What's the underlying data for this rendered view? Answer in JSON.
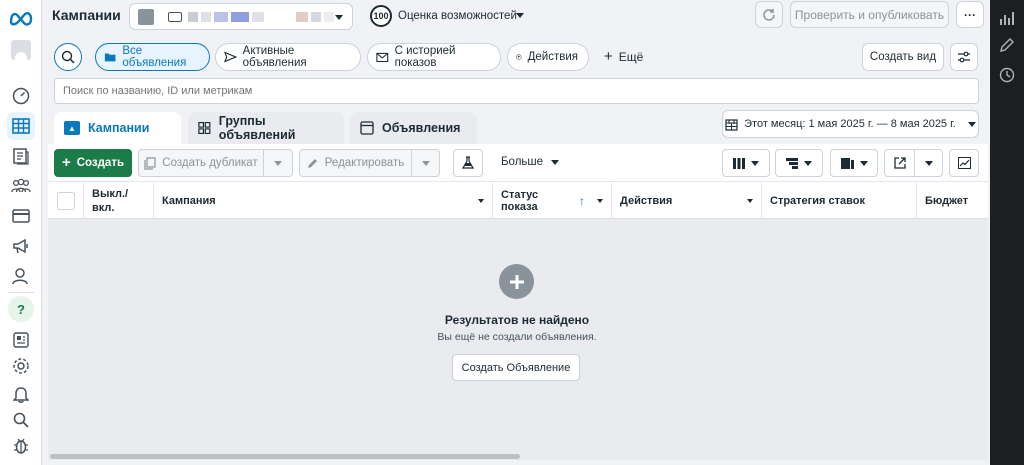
{
  "header": {
    "title": "Кампании",
    "opportunity_score": "100",
    "opportunity_label": "Оценка возможностей",
    "review_publish": "Проверить и опубликовать",
    "more": "···"
  },
  "filters": {
    "items": [
      {
        "label": "Все объявления",
        "selected": true,
        "icon": "folder-icon"
      },
      {
        "label": "Активные объявления",
        "selected": false,
        "icon": "send-icon"
      },
      {
        "label": "С историей показов",
        "selected": false,
        "icon": "mail-icon"
      },
      {
        "label": "Действия",
        "selected": false,
        "icon": "arrow-up-circle-icon"
      }
    ],
    "more_label": "Ещё",
    "create_view": "Создать вид"
  },
  "search": {
    "placeholder": "Поиск по названию, ID или метрикам"
  },
  "tabs": [
    {
      "label": "Кампании",
      "active": true
    },
    {
      "label": "Группы объявлений",
      "active": false
    },
    {
      "label": "Объявления",
      "active": false
    }
  ],
  "date_range": "Этот месяц: 1 мая 2025 г. — 8 мая 2025 г.",
  "toolbar": {
    "create": "Создать",
    "duplicate": "Создать дубликат",
    "edit": "Редактировать",
    "more": "Больше"
  },
  "table": {
    "columns": [
      "Выкл./\nвкл.",
      "Кампания",
      "Статус показа",
      "Действия",
      "Стратегия ставок",
      "Бюджет"
    ]
  },
  "empty": {
    "title": "Результатов не найдено",
    "subtitle": "Вы ещё не создали объявления.",
    "button": "Создать Объявление"
  },
  "colors": {
    "accent": "#0a78be",
    "create_green": "#1b7c4a"
  }
}
